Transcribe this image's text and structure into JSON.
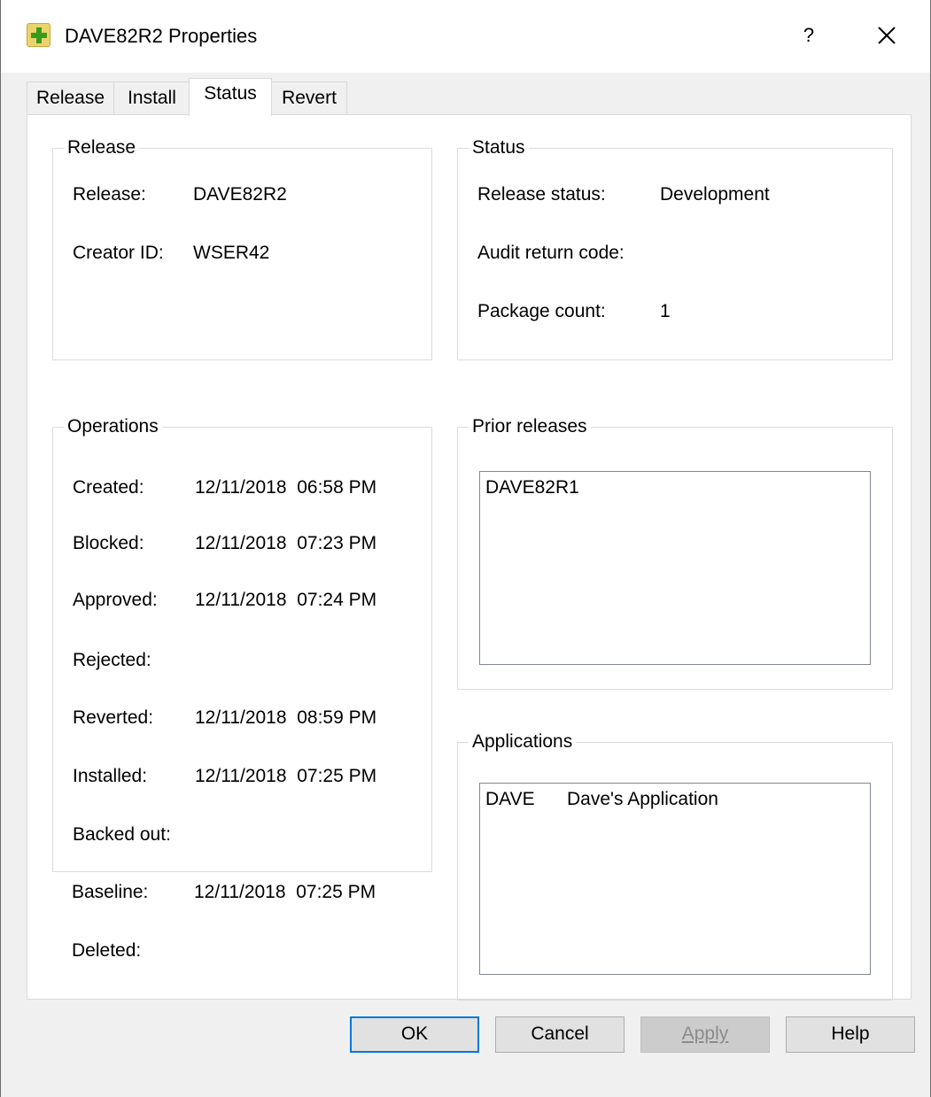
{
  "window": {
    "title": "DAVE82R2 Properties",
    "help_glyph": "?",
    "icon": "plus-icon"
  },
  "tabs": [
    {
      "label": "Release"
    },
    {
      "label": "Install"
    },
    {
      "label": "Status",
      "active": true
    },
    {
      "label": "Revert"
    }
  ],
  "release_group": {
    "title": "Release",
    "release_label": "Release:",
    "release_value": "DAVE82R2",
    "creator_label": "Creator ID:",
    "creator_value": "WSER42"
  },
  "status_group": {
    "title": "Status",
    "release_status_label": "Release status:",
    "release_status_value": "Development",
    "audit_label": "Audit return code:",
    "audit_value": "",
    "package_count_label": "Package count:",
    "package_count_value": "1"
  },
  "operations_group": {
    "title": "Operations",
    "rows": [
      {
        "label": "Created:",
        "value": "12/11/2018  06:58 PM"
      },
      {
        "label": "Blocked:",
        "value": "12/11/2018  07:23 PM"
      },
      {
        "label": "Approved:",
        "value": "12/11/2018  07:24 PM"
      },
      {
        "label": "Rejected:",
        "value": ""
      },
      {
        "label": "Reverted:",
        "value": "12/11/2018  08:59 PM"
      },
      {
        "label": "Installed:",
        "value": "12/11/2018  07:25 PM"
      },
      {
        "label": "Backed out:",
        "value": ""
      },
      {
        "label": "Baseline:",
        "value": "12/11/2018  07:25 PM"
      },
      {
        "label": "Deleted:",
        "value": ""
      }
    ]
  },
  "prior_releases_group": {
    "title": "Prior releases",
    "items": [
      "DAVE82R1"
    ]
  },
  "applications_group": {
    "title": "Applications",
    "items": [
      {
        "code": "DAVE",
        "name": "Dave's Application"
      }
    ]
  },
  "buttons": {
    "ok": "OK",
    "cancel": "Cancel",
    "apply": "Apply",
    "help": "Help"
  },
  "colors": {
    "accent": "#0078d7",
    "icon_bg": "#ecd46a",
    "icon_plus": "#3a9a1e"
  }
}
